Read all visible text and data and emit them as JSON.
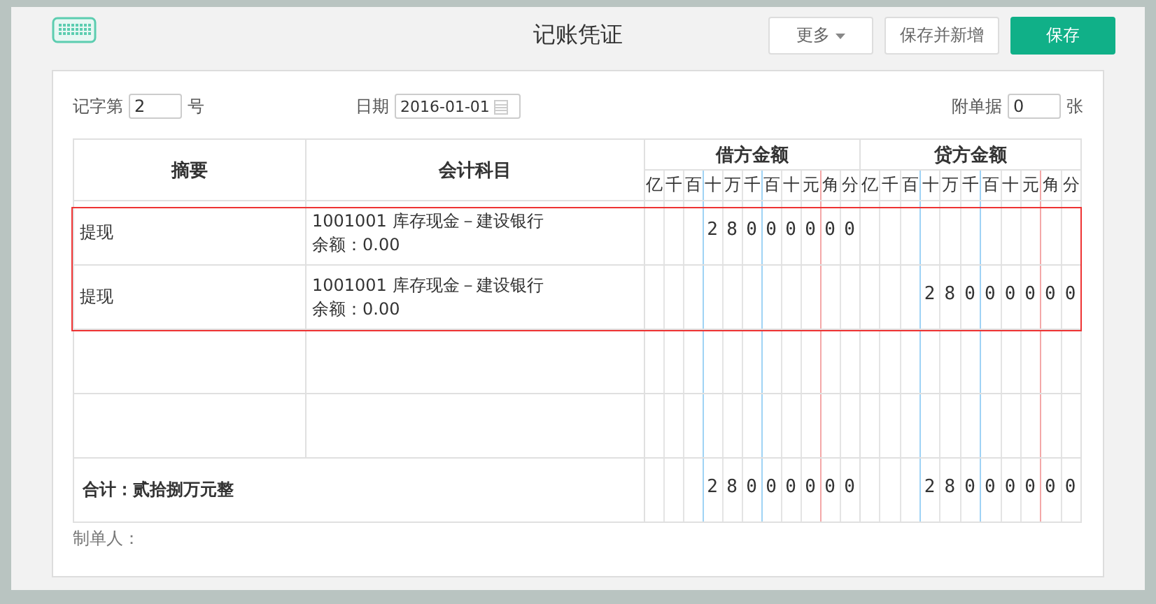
{
  "title": "记账凭证",
  "buttons": [
    {
      "label": "更多",
      "kind": "dropdown"
    },
    {
      "label": "保存并新增",
      "kind": "plain"
    },
    {
      "label": "保存",
      "kind": "primary"
    }
  ],
  "voucher": {
    "word_label": "记字第",
    "word_value": "2",
    "word_suffix": "号",
    "date_label": "日期",
    "date_value": "2016-01-01",
    "attach_label": "附单据",
    "attach_value": "0",
    "attach_suffix": "张"
  },
  "table": {
    "columns": [
      "摘要",
      "会计科目",
      "借方金额",
      "贷方金额"
    ],
    "units": [
      "亿",
      "千",
      "百",
      "十",
      "万",
      "千",
      "百",
      "十",
      "元",
      "角",
      "分"
    ],
    "credit_units": [
      "亿",
      "千",
      "百",
      "十",
      "万",
      "千",
      "百",
      "十",
      "元",
      "角",
      "分"
    ],
    "rows": [
      {
        "summary": "提现",
        "account": "1001001 库存现金－建设银行",
        "balance": "余额：0.00",
        "debit": "28000000",
        "credit": "",
        "selected": true
      },
      {
        "summary": "提现",
        "account": "1001001 库存现金－建设银行",
        "balance": "余额：0.00",
        "debit": "",
        "credit": "28000000",
        "selected": true
      },
      {
        "summary": "",
        "account": "",
        "balance": "",
        "debit": "",
        "credit": "",
        "selected": false
      },
      {
        "summary": "",
        "account": "",
        "balance": "",
        "debit": "",
        "credit": "",
        "selected": false
      }
    ],
    "total_label": "合计：贰拾捌万元整",
    "total_debit": "28000000",
    "total_credit": "28000000"
  },
  "maker_label": "制单人："
}
